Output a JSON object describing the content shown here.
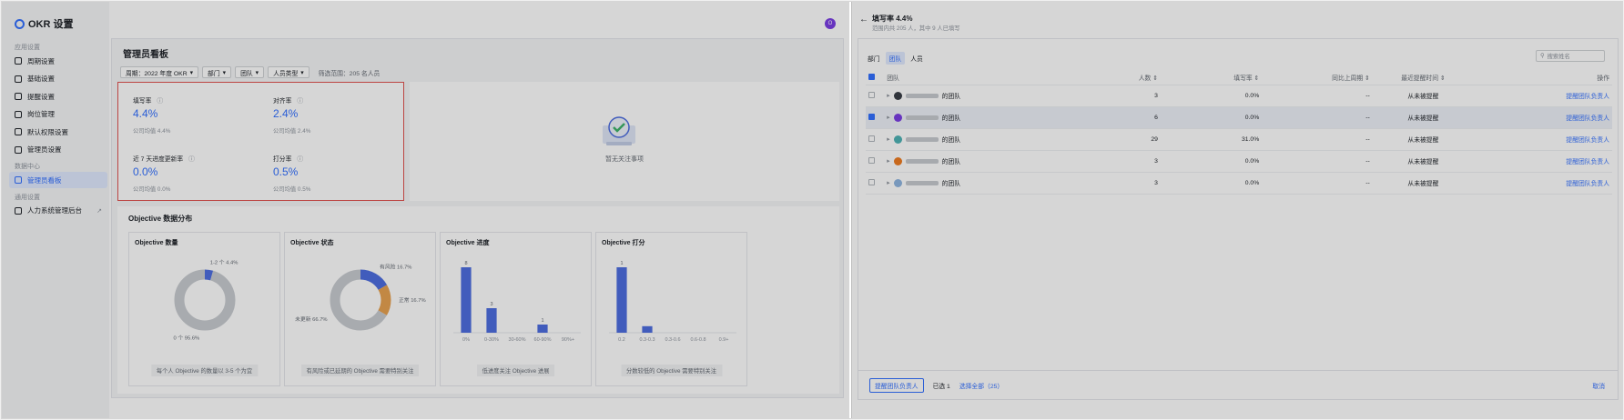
{
  "app": {
    "title": "OKR 设置",
    "avatar": "O"
  },
  "sidebar": {
    "groups": [
      {
        "label": "应用设置",
        "items": [
          {
            "label": "周期设置",
            "icon": "calendar-icon"
          },
          {
            "label": "基础设置",
            "icon": "settings-icon"
          },
          {
            "label": "提醒设置",
            "icon": "bell-icon"
          },
          {
            "label": "岗位管理",
            "icon": "edit-icon"
          },
          {
            "label": "默认权限设置",
            "icon": "lock-icon"
          },
          {
            "label": "管理员设置",
            "icon": "user-icon"
          }
        ]
      },
      {
        "label": "数据中心",
        "items": [
          {
            "label": "管理员看板",
            "icon": "dashboard-icon",
            "active": true
          }
        ]
      },
      {
        "label": "通用设置",
        "items": [
          {
            "label": "人力系统管理后台",
            "icon": "org-icon",
            "external": "↗"
          }
        ]
      }
    ]
  },
  "dashboard": {
    "title": "管理员看板",
    "filters": [
      {
        "label": "周期：2022 年度 OKR",
        "caret": "▾"
      },
      {
        "label": "部门",
        "caret": "▾"
      },
      {
        "label": "团队",
        "caret": "▾"
      },
      {
        "label": "人员类型",
        "caret": "▾"
      }
    ],
    "scope": "筛选范围：205 名人员",
    "metrics": [
      {
        "title": "填写率",
        "value": "4.4%",
        "sub": "公司均值 4.4%"
      },
      {
        "title": "对齐率",
        "value": "2.4%",
        "sub": "公司均值 2.4%"
      },
      {
        "title": "近 7 天进度更新率",
        "value": "0.0%",
        "sub": "公司均值 0.0%"
      },
      {
        "title": "打分率",
        "value": "0.5%",
        "sub": "公司均值 0.5%"
      }
    ],
    "info_glyph": "ⓘ",
    "follow_label": "暂无关注事项",
    "dist_title": "Objective 数据分布",
    "cards": [
      {
        "title": "Objective 数量",
        "caption": "每个人 Objective 的数量以 3-5 个为宜"
      },
      {
        "title": "Objective 状态",
        "caption": "有风险或已延期的 Objective 需要特别关注"
      },
      {
        "title": "Objective 进度",
        "caption": "低进度关注 Objective 进展"
      },
      {
        "title": "Objective 打分",
        "caption": "分数较低的 Objective 需要特别关注"
      }
    ]
  },
  "chart_data": [
    {
      "type": "pie",
      "title": "Objective 数量",
      "slices": [
        {
          "label": "1-2 个 4.4%",
          "value": 4.4,
          "color": "#4e6ee0"
        },
        {
          "label": "0 个 95.6%",
          "value": 95.6,
          "color": "#c9ccd1"
        }
      ]
    },
    {
      "type": "pie",
      "title": "Objective 状态",
      "slices": [
        {
          "label": "有风险 16.7%",
          "value": 16.7,
          "color": "#4e6ee0"
        },
        {
          "label": "正常 16.7%",
          "value": 16.7,
          "color": "#e8a252"
        },
        {
          "label": "未更新 66.7%",
          "value": 66.7,
          "color": "#c9ccd1"
        }
      ]
    },
    {
      "type": "bar",
      "title": "Objective 进度",
      "categories": [
        "0%",
        "0-30%",
        "30-60%",
        "60-90%",
        "90%+"
      ],
      "values": [
        8,
        3,
        0,
        1,
        0
      ],
      "ylim": [
        0,
        8
      ],
      "color": "#4e6ee0"
    },
    {
      "type": "bar",
      "title": "Objective 打分",
      "categories": [
        "0.2",
        "0.3-0.3",
        "0.3-0.6",
        "0.6-0.8",
        "0.9+"
      ],
      "values": [
        1,
        0.1,
        0,
        0,
        0
      ],
      "data_labels": [
        "1",
        "",
        "",
        "",
        ""
      ],
      "ylim": [
        0,
        1
      ],
      "color": "#4e6ee0"
    }
  ],
  "right_panel": {
    "back": "←",
    "title": "填写率 4.4%",
    "subtitle": "范围内共 205 人，其中 9 人已填写",
    "tabs": [
      "部门",
      "团队",
      "人员"
    ],
    "active_tab": 1,
    "search_placeholder": "搜索姓名",
    "columns": [
      "团队",
      "人数 ⇕",
      "填写率 ⇕",
      "同比上周期 ⇕",
      "最近提醒时间 ⇕",
      "操作"
    ],
    "rows": [
      {
        "suffix": "的团队",
        "people": "3",
        "rate": "0.0%",
        "delta": "--",
        "last": "从未被提醒",
        "action": "提醒团队负责人",
        "selected": false,
        "color": "#3a3f47"
      },
      {
        "suffix": "的团队",
        "people": "6",
        "rate": "0.0%",
        "delta": "--",
        "last": "从未被提醒",
        "action": "提醒团队负责人",
        "selected": true,
        "color": "#7b3fe4"
      },
      {
        "suffix": "的团队",
        "people": "29",
        "rate": "31.0%",
        "delta": "--",
        "last": "从未被提醒",
        "action": "提醒团队负责人",
        "selected": false,
        "color": "#4fb3b6"
      },
      {
        "suffix": "的团队",
        "people": "3",
        "rate": "0.0%",
        "delta": "--",
        "last": "从未被提醒",
        "action": "提醒团队负责人",
        "selected": false,
        "color": "#ef7d22"
      },
      {
        "suffix": "的团队",
        "people": "3",
        "rate": "0.0%",
        "delta": "--",
        "last": "从未被提醒",
        "action": "提醒团队负责人",
        "selected": false,
        "color": "#8fb6e0"
      }
    ],
    "footer": {
      "remind_btn": "提醒团队负责人",
      "selected": "已选 1",
      "select_all": "选择全部（25）",
      "cancel": "取消"
    }
  }
}
